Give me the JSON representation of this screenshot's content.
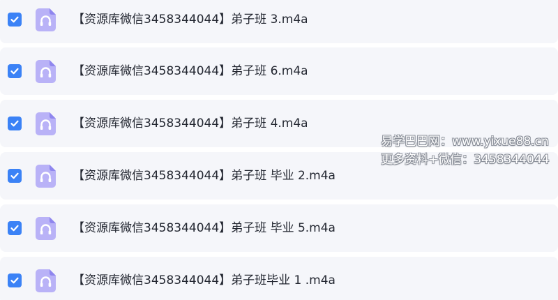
{
  "colors": {
    "checkbox": "#3b82f6",
    "file_icon_bg": "#b9b2f7",
    "file_icon_fold": "#8f86ee",
    "row_bg": "#f5f6fa",
    "text": "#222630"
  },
  "files": [
    {
      "name": "【资源库微信3458344044】弟子班 3.m4a",
      "checked": true,
      "icon": "audio-file-icon"
    },
    {
      "name": "【资源库微信3458344044】弟子班 6.m4a",
      "checked": true,
      "icon": "audio-file-icon"
    },
    {
      "name": "【资源库微信3458344044】弟子班 4.m4a",
      "checked": true,
      "icon": "audio-file-icon"
    },
    {
      "name": "【资源库微信3458344044】弟子班 毕业 2.m4a",
      "checked": true,
      "icon": "audio-file-icon"
    },
    {
      "name": "【资源库微信3458344044】弟子班 毕业 5.m4a",
      "checked": true,
      "icon": "audio-file-icon"
    },
    {
      "name": "【资源库微信3458344044】弟子班毕业 1 .m4a",
      "checked": true,
      "icon": "audio-file-icon"
    }
  ],
  "watermark": {
    "line1": "易学巴巴网：www.yixue88.cn",
    "line2": "更多资料+微信：3458344044"
  }
}
